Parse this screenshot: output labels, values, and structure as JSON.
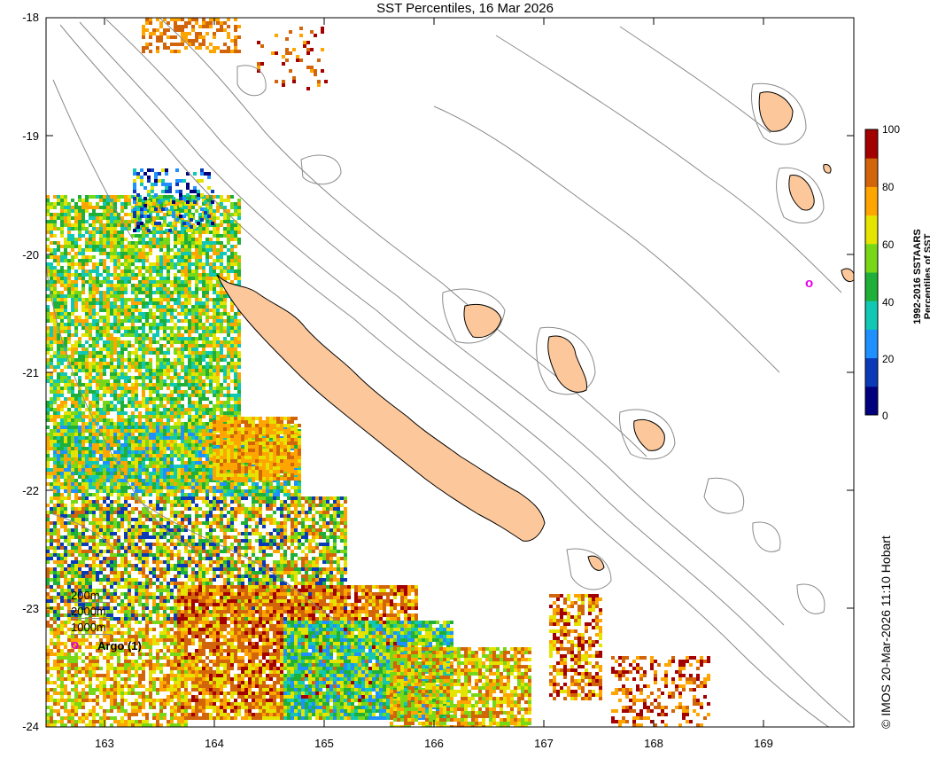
{
  "title": "SST Percentiles, 16 Mar 2026",
  "credit": "© IMOS 20-Mar-2026 11:10 Hobart",
  "axes": {
    "y_ticks": [
      "-18",
      "-19",
      "-20",
      "-21",
      "-22",
      "-23",
      "-24"
    ],
    "x_ticks": [
      "163",
      "164",
      "165",
      "166",
      "167",
      "168",
      "169"
    ],
    "lon_range": [
      162.5,
      169.8
    ],
    "lat_range": [
      -24,
      -18
    ]
  },
  "colorbar": {
    "title_line1": "1992-2016 SSTAARS",
    "title_line2": "Percentiles of SST",
    "ticks": [
      "0",
      "20",
      "40",
      "60",
      "80",
      "100"
    ],
    "colors": [
      "#00007f",
      "#0a3ab8",
      "#1e90ff",
      "#10c8b4",
      "#1fb03a",
      "#78d818",
      "#e4e400",
      "#ffa500",
      "#d2640a",
      "#a30000"
    ]
  },
  "legend": {
    "items": [
      "200m",
      "2000m",
      "1000m"
    ],
    "argo_symbol": "o",
    "argo_label": "Argo (1)"
  },
  "map": {
    "argo_float_symbol": "o",
    "land_color": "#fcc89b",
    "contour_color": "#8a8a8a"
  }
}
